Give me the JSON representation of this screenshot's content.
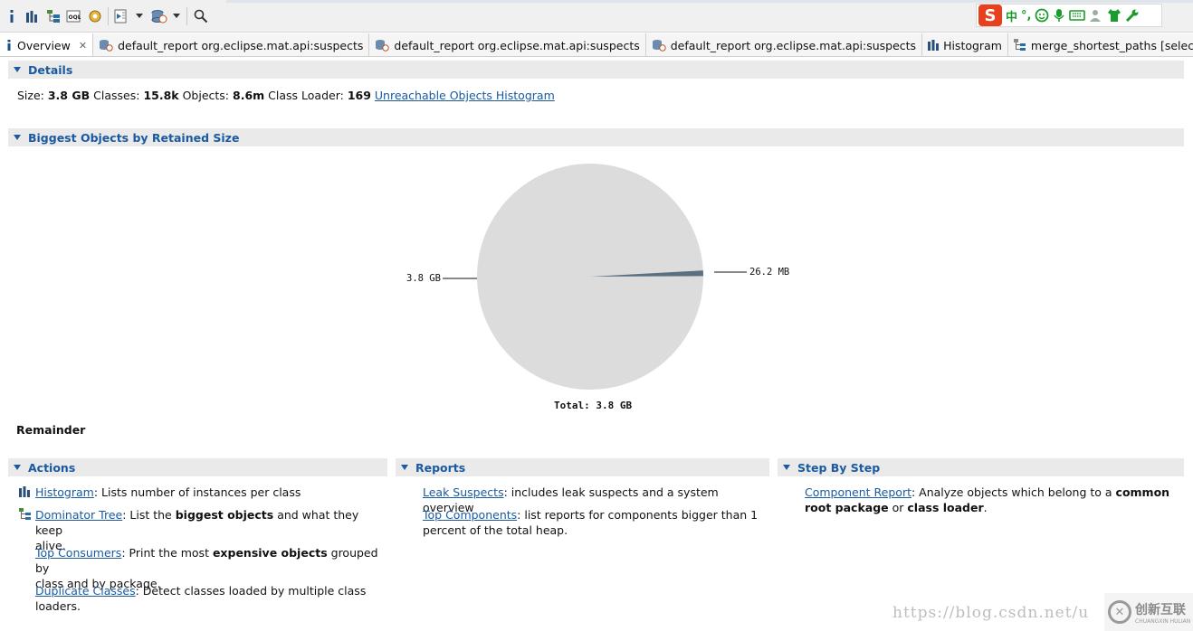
{
  "toolbar": {
    "icons": [
      "info-icon",
      "histogram-icon",
      "dominator-tree-icon",
      "oql-icon",
      "heap-dump-overview-icon",
      "run-report-icon",
      "dropdown-arrow-icon",
      "query-browser-icon",
      "dropdown-arrow-icon",
      "search-icon"
    ]
  },
  "ime": {
    "s": "S",
    "zh": "中",
    "punct": "°,",
    "icons": [
      "smiley-icon",
      "mic-icon",
      "keyboard-icon",
      "user-icon",
      "shirt-icon",
      "wrench-icon"
    ]
  },
  "tabs": [
    {
      "icon": "info-icon",
      "label": "Overview",
      "active": true,
      "closable": true
    },
    {
      "icon": "report-icon",
      "label": "default_report  org.eclipse.mat.api:suspects"
    },
    {
      "icon": "report-icon",
      "label": "default_report  org.eclipse.mat.api:suspects"
    },
    {
      "icon": "report-icon",
      "label": "default_report  org.eclipse.mat.api:suspects"
    },
    {
      "icon": "histogram-icon",
      "label": "Histogram"
    },
    {
      "icon": "merge-paths-icon",
      "label": "merge_shortest_paths [selection of 'Object[]."
    }
  ],
  "details": {
    "title": "Details",
    "size_label": "Size:",
    "size_value": "3.8 GB",
    "classes_label": "Classes:",
    "classes_value": "15.8k",
    "objects_label": "Objects:",
    "objects_value": "8.6m",
    "loader_label": "Class Loader:",
    "loader_value": "169",
    "unreachable_link": "Unreachable Objects Histogram"
  },
  "biggest": {
    "title": "Biggest Objects by Retained Size",
    "remainder": "Remainder"
  },
  "chart_data": {
    "type": "pie",
    "values": [
      3.8,
      0.0262
    ],
    "labels": [
      "3.8 GB",
      "26.2 MB"
    ],
    "total": "Total: 3.8 GB",
    "colors": [
      "#dcdcdc",
      "#5a7080"
    ]
  },
  "actions": {
    "title": "Actions",
    "items": [
      {
        "link": "Histogram",
        "text": ": Lists number of instances per class"
      },
      {
        "link": "Dominator Tree",
        "t1": ": List the ",
        "b1": "biggest objects",
        "t2": " and what they keep",
        "t3": "alive."
      },
      {
        "link": "Top Consumers",
        "t1": ": Print the most ",
        "b1": "expensive objects",
        "t2": " grouped by",
        "t3": "class and by package."
      },
      {
        "link": "Duplicate Classes",
        "t1": ": Detect classes loaded by multiple class",
        "t3": "loaders."
      }
    ]
  },
  "reports": {
    "title": "Reports",
    "items": [
      {
        "link": "Leak Suspects",
        "text": ": includes leak suspects and a system overview"
      },
      {
        "link": "Top Components",
        "t1": ": list reports for components bigger than 1",
        "t3": "percent of the total heap."
      }
    ]
  },
  "step": {
    "title": "Step By Step",
    "link": "Component Report",
    "t1": ": Analyze objects which belong to a ",
    "b1": "common",
    "b2": "root package",
    "t2": " or ",
    "b3": "class loader",
    "t3": "."
  },
  "watermark": {
    "url": "https://blog.csdn.net/u",
    "logo_text": "创新互联",
    "logo_sub": "CHUANGXIN HULIAN"
  }
}
